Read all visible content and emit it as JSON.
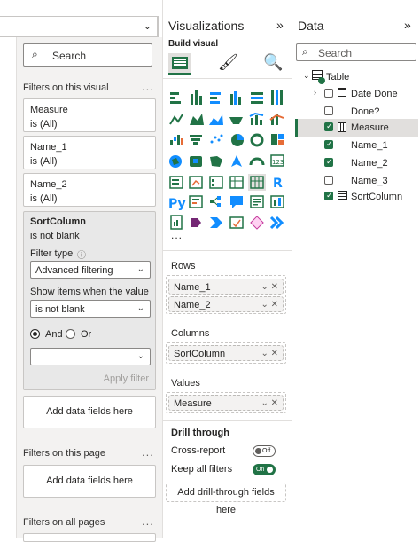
{
  "filters": {
    "search_placeholder": "Search",
    "on_visual_label": "Filters on this visual",
    "more": "...",
    "cards": [
      {
        "title": "Measure",
        "state": "is (All)"
      },
      {
        "title": "Name_1",
        "state": "is (All)"
      },
      {
        "title": "Name_2",
        "state": "is (All)"
      }
    ],
    "sort": {
      "title": "SortColumn",
      "state": "is not blank",
      "filter_type_label": "Filter type",
      "filter_type_value": "Advanced filtering",
      "show_items_label": "Show items when the value",
      "condition_value": "is not blank",
      "and_label": "And",
      "or_label": "Or",
      "second_value": "",
      "apply_label": "Apply filter"
    },
    "add_fields": "Add data fields here",
    "on_page_label": "Filters on this page",
    "on_all_label": "Filters on all pages"
  },
  "viz": {
    "title": "Visualizations",
    "build_label": "Build visual",
    "more_icons": "...",
    "rows_label": "Rows",
    "rows": [
      "Name_1",
      "Name_2"
    ],
    "columns_label": "Columns",
    "columns": [
      "SortColumn"
    ],
    "values_label": "Values",
    "values": [
      "Measure"
    ],
    "drill_label": "Drill through",
    "cross_report_label": "Cross-report",
    "cross_report_state": "Off",
    "keep_filters_label": "Keep all filters",
    "keep_filters_state": "On",
    "add_drill": "Add drill-through fields here"
  },
  "data": {
    "title": "Data",
    "search_placeholder": "Search",
    "table_name": "Table",
    "fields": [
      {
        "name": "Date Done",
        "checked": false,
        "kind": "calendar"
      },
      {
        "name": "Done?",
        "checked": false,
        "kind": "plain"
      },
      {
        "name": "Measure",
        "checked": true,
        "kind": "calc"
      },
      {
        "name": "Name_1",
        "checked": true,
        "kind": "plain"
      },
      {
        "name": "Name_2",
        "checked": true,
        "kind": "plain"
      },
      {
        "name": "Name_3",
        "checked": false,
        "kind": "plain"
      },
      {
        "name": "SortColumn",
        "checked": true,
        "kind": "calctable"
      }
    ]
  },
  "colors": {
    "accent": "#217346",
    "pane": "#f3f2f1",
    "selected_row": "#e1dfdd"
  }
}
